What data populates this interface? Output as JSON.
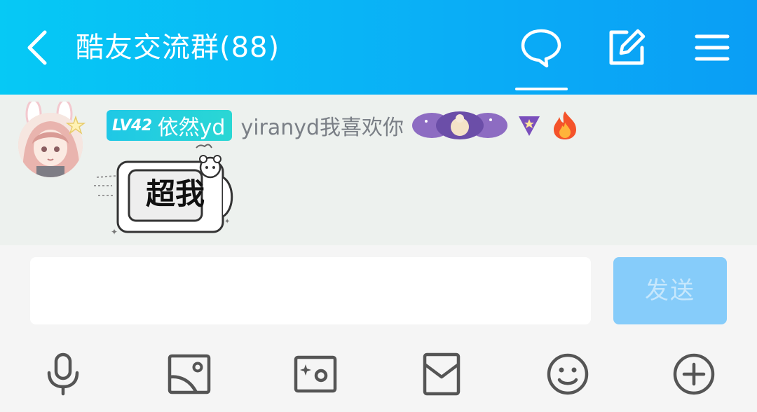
{
  "header": {
    "title": "酷友交流群(88)",
    "accent_color": "#0ab4f6",
    "icons": [
      "back-arrow-icon",
      "chat-bubble-icon",
      "edit-icon",
      "menu-icon"
    ]
  },
  "message": {
    "level_badge": "LV42",
    "group_name": "依然yd",
    "nickname": "yiranyd我喜欢你",
    "sticker_text": "超我",
    "badges": [
      "purple-decoration-badge",
      "purple-triangle-badge",
      "fire-badge"
    ]
  },
  "composer": {
    "input_value": "",
    "input_placeholder": "",
    "send_label": "发送"
  },
  "toolbar": {
    "items": [
      "microphone-icon",
      "image-icon",
      "camera-icon",
      "red-packet-icon",
      "emoji-icon",
      "plus-icon"
    ]
  }
}
